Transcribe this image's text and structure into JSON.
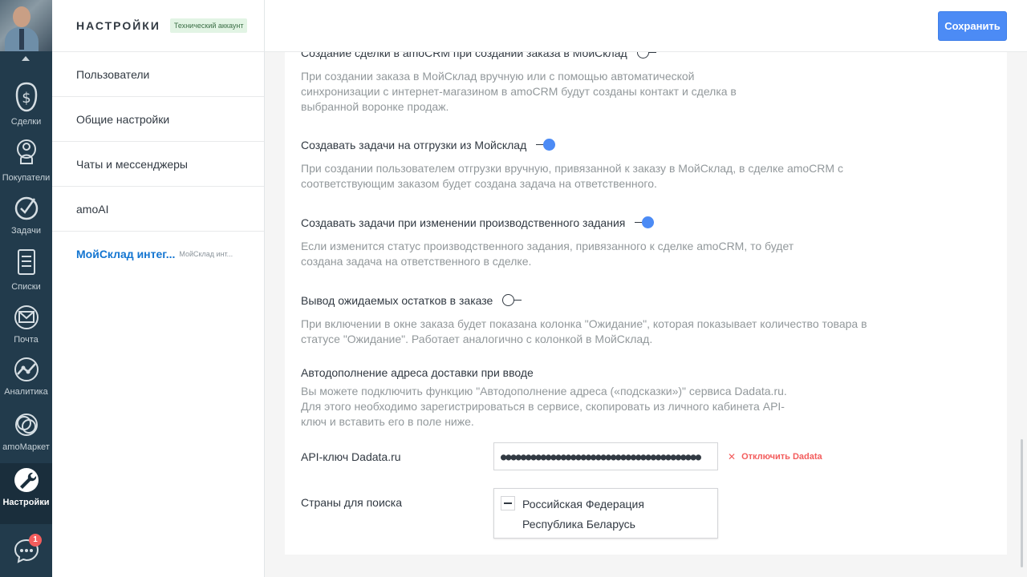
{
  "nav": {
    "items": [
      {
        "label": "Сделки",
        "icon": "dollar-icon"
      },
      {
        "label": "Покупатели",
        "icon": "customers-icon"
      },
      {
        "label": "Задачи",
        "icon": "tasks-icon"
      },
      {
        "label": "Списки",
        "icon": "lists-icon"
      },
      {
        "label": "Почта",
        "icon": "mail-icon"
      },
      {
        "label": "Аналитика",
        "icon": "analytics-icon"
      },
      {
        "label": "amoМаркет",
        "icon": "market-icon"
      },
      {
        "label": "Настройки",
        "icon": "settings-icon"
      }
    ],
    "active_index": 7,
    "chat_badge": "1"
  },
  "sidebar": {
    "title": "НАСТРОЙКИ",
    "tag": "Технический аккаунт",
    "items": [
      {
        "label": "Пользователи"
      },
      {
        "label": "Общие настройки"
      },
      {
        "label": "Чаты и мессенджеры"
      },
      {
        "label": "amoAI"
      },
      {
        "label": "МойСклад интег...",
        "sub": "МойСклад инт..."
      }
    ]
  },
  "toolbar": {
    "save_label": "Сохранить"
  },
  "settings": [
    {
      "title": "Создание сделки в amoCRM при создании заказа в МойСклад",
      "enabled": false,
      "desc": "При создании заказа в МойСклад вручную или с помощью автоматической синхронизации с интернет-магазином в amoCRM будут созданы контакт и сделка в выбранной воронке продаж."
    },
    {
      "title": "Создавать задачи на отгрузки из Мойсклад",
      "enabled": true,
      "desc": "При создании пользователем отгрузки вручную, привязанной к заказу в МойСклад, в сделке amoCRM с соответствующим заказом будет создана задача на ответственного."
    },
    {
      "title": "Создавать задачи при изменении производственного задания",
      "enabled": true,
      "desc": "Если изменится статус производственного задания, привязанного к сделке amoCRM, то будет создана задача на ответственного в сделке."
    },
    {
      "title": "Вывод ожидаемых остатков в заказе",
      "enabled": false,
      "desc": "При включении в окне заказа будет показана колонка \"Ожидание\", которая показывает количество товара в статусе \"Ожидание\". Работает аналогично с колонкой в МойСклад."
    }
  ],
  "autocomplete": {
    "title": "Автодополнение адреса доставки при вводе",
    "desc": "Вы можете подключить функцию \"Автодополнение адреса («подсказки»)\" сервиса Dadata.ru. Для этого необходимо зарегистрироваться в сервисе, скопировать из личного кабинета API-ключ и вставить его в поле ниже."
  },
  "api": {
    "label": "API-ключ Dadata.ru",
    "value": "●●●●●●●●●●●●●●●●●●●●●●●●●●●●●●●●●●●●●●●●",
    "disconnect_label": "Отключить Dadata"
  },
  "countries": {
    "label": "Страны для поиска",
    "options": [
      "Российская Федерация",
      "Республика Беларусь"
    ]
  },
  "colors": {
    "accent": "#4c8bf5",
    "nav_bg": "#223b4c",
    "danger": "#f35d5d"
  }
}
